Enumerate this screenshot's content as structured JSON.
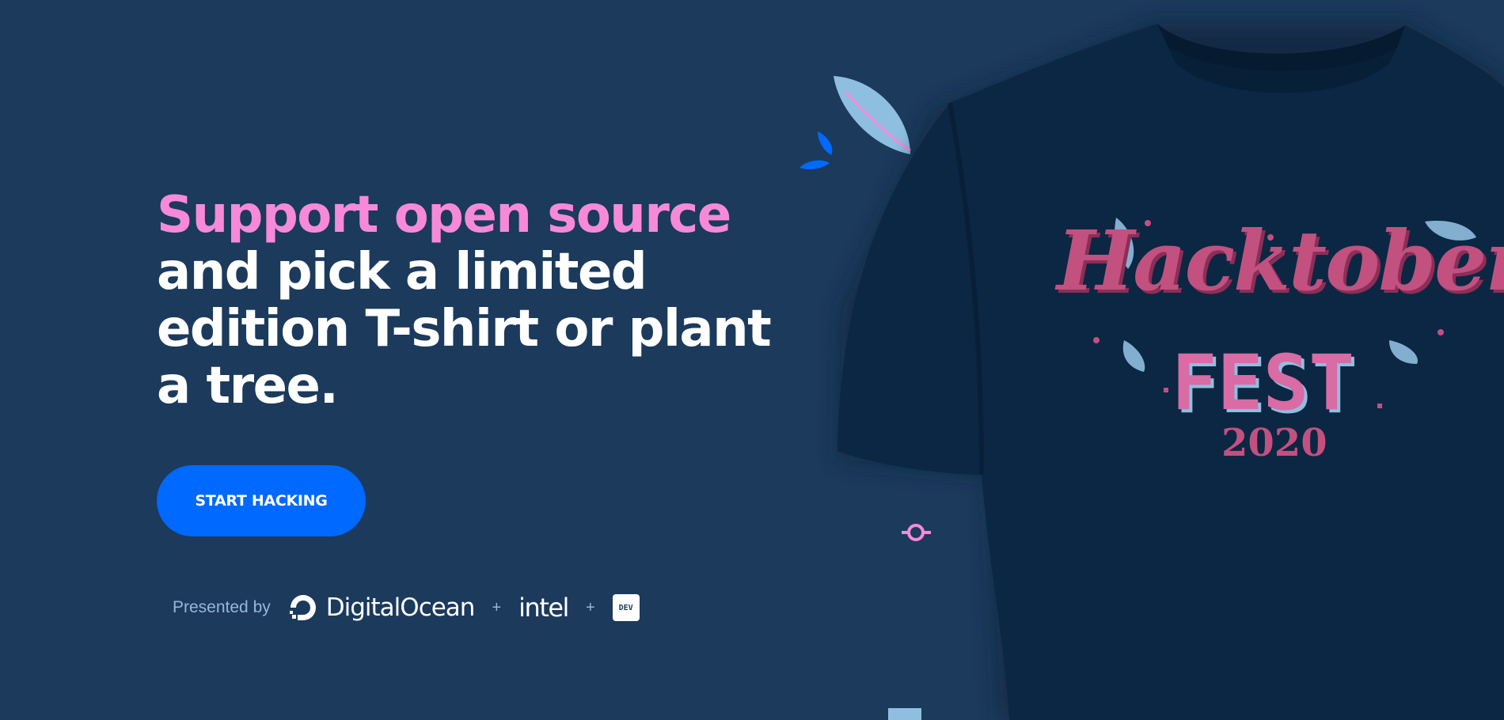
{
  "hero": {
    "headline_accent": "Support open source",
    "headline_rest": "and pick a limited edition T-shirt or plant a tree.",
    "cta_label": "START HACKING"
  },
  "sponsors": {
    "label": "Presented by",
    "digitalocean": "DigitalOcean",
    "plus_1": "+",
    "intel": "intel",
    "plus_2": "+",
    "dev": "DEV"
  },
  "tshirt": {
    "print_line_1": "Hacktober",
    "print_line_2": "FEST",
    "print_line_3": "2020"
  },
  "colors": {
    "background": "#1b3a5c",
    "accent_pink": "#f78ad8",
    "cta_blue": "#0069ff",
    "shirt": "#0b2743"
  }
}
